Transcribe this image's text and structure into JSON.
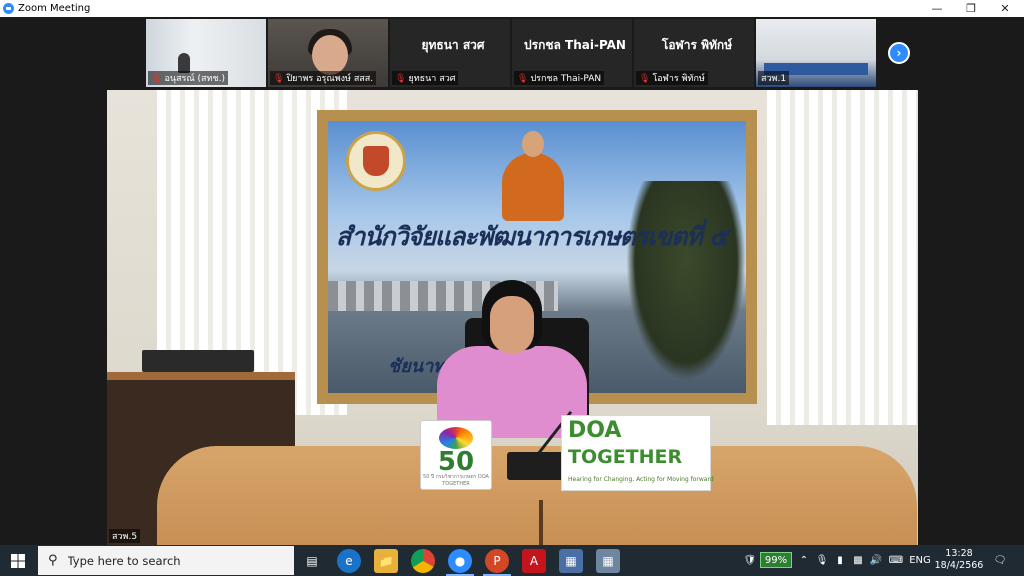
{
  "window": {
    "title": "Zoom Meeting"
  },
  "colors": {
    "accent": "#2d8cff",
    "mic_muted": "#e5322d",
    "battery": "#2e7d32"
  },
  "participants": [
    {
      "name": "",
      "label": "อนุสรณ์ (สทช.)",
      "muted": true,
      "video": true
    },
    {
      "name": "",
      "label": "ปิยาพร อรุณพงษ์ สสส.",
      "muted": true,
      "video": true
    },
    {
      "name": "ยุทธนา สวศ",
      "label": "ยุทธนา สวศ",
      "muted": true,
      "video": false
    },
    {
      "name": "ปรกชล Thai-PAN",
      "label": "ปรกชล Thai-PAN",
      "muted": true,
      "video": false
    },
    {
      "name": "โอฬาร พิทักษ์",
      "label": "โอฬาร พิทักษ์",
      "muted": true,
      "video": false
    },
    {
      "name": "",
      "label": "สวพ.1",
      "muted": false,
      "video": true
    }
  ],
  "speaker": {
    "label": "สวพ.5",
    "poster_title": "สำนักวิจัยและพัฒนาการเกษตรเขตที่ ๕",
    "poster_sub": "ชัยนาท  ...  ปทุมธานี",
    "sign_50": "50",
    "sign_50_caption": "50 ปี กรมวิชาการเกษตร DOA TOGETHER",
    "doa_line1": "DOA",
    "doa_line2": "TOGETHER",
    "doa_line3": "Hearing for Changing, Acting for Moving forward"
  },
  "taskbar": {
    "search_placeholder": "Type here to search",
    "battery": "99%",
    "language": "ENG",
    "time": "13:28",
    "date": "18/4/2566",
    "pinned": [
      "task-view",
      "edge",
      "file-explorer",
      "chrome",
      "zoom",
      "powerpoint",
      "acrobat",
      "app-1",
      "app-2"
    ]
  }
}
